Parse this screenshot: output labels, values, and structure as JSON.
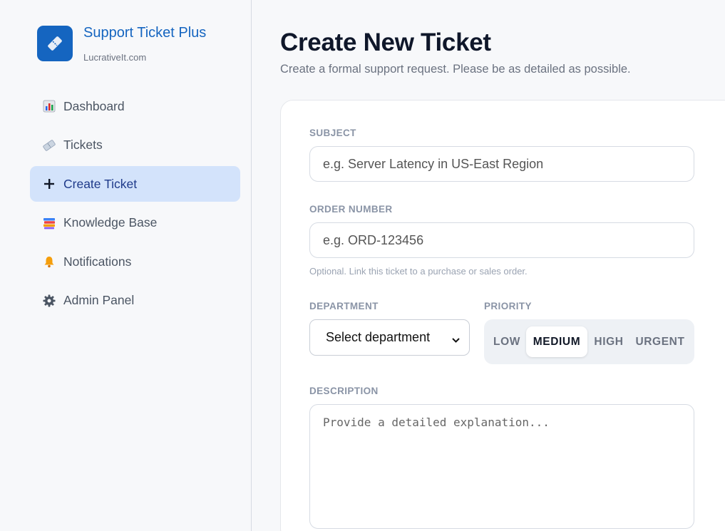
{
  "brand": {
    "title": "Support Ticket Plus",
    "subtitle": "LucrativeIt.com",
    "logo_icon": "ticket-icon",
    "color": "#1565c0"
  },
  "nav": {
    "items": [
      {
        "label": "Dashboard",
        "icon": "bar-chart-icon"
      },
      {
        "label": "Tickets",
        "icon": "ticket-icon"
      },
      {
        "label": "Create Ticket",
        "icon": "plus-icon",
        "active": true
      },
      {
        "label": "Knowledge Base",
        "icon": "books-icon"
      },
      {
        "label": "Notifications",
        "icon": "bell-icon"
      },
      {
        "label": "Admin Panel",
        "icon": "gear-icon"
      }
    ]
  },
  "page": {
    "title": "Create New Ticket",
    "subtitle": "Create a formal support request. Please be as detailed as possible."
  },
  "form": {
    "subject": {
      "label": "SUBJECT",
      "placeholder": "e.g. Server Latency in US-East Region",
      "value": ""
    },
    "order_number": {
      "label": "ORDER NUMBER",
      "placeholder": "e.g. ORD-123456",
      "value": "",
      "hint": "Optional. Link this ticket to a purchase or sales order."
    },
    "department": {
      "label": "DEPARTMENT",
      "selected": "Select department"
    },
    "priority": {
      "label": "PRIORITY",
      "options": [
        "LOW",
        "MEDIUM",
        "HIGH",
        "URGENT"
      ],
      "selected": "MEDIUM"
    },
    "description": {
      "label": "DESCRIPTION",
      "placeholder": "Provide a detailed explanation...",
      "value": ""
    }
  }
}
